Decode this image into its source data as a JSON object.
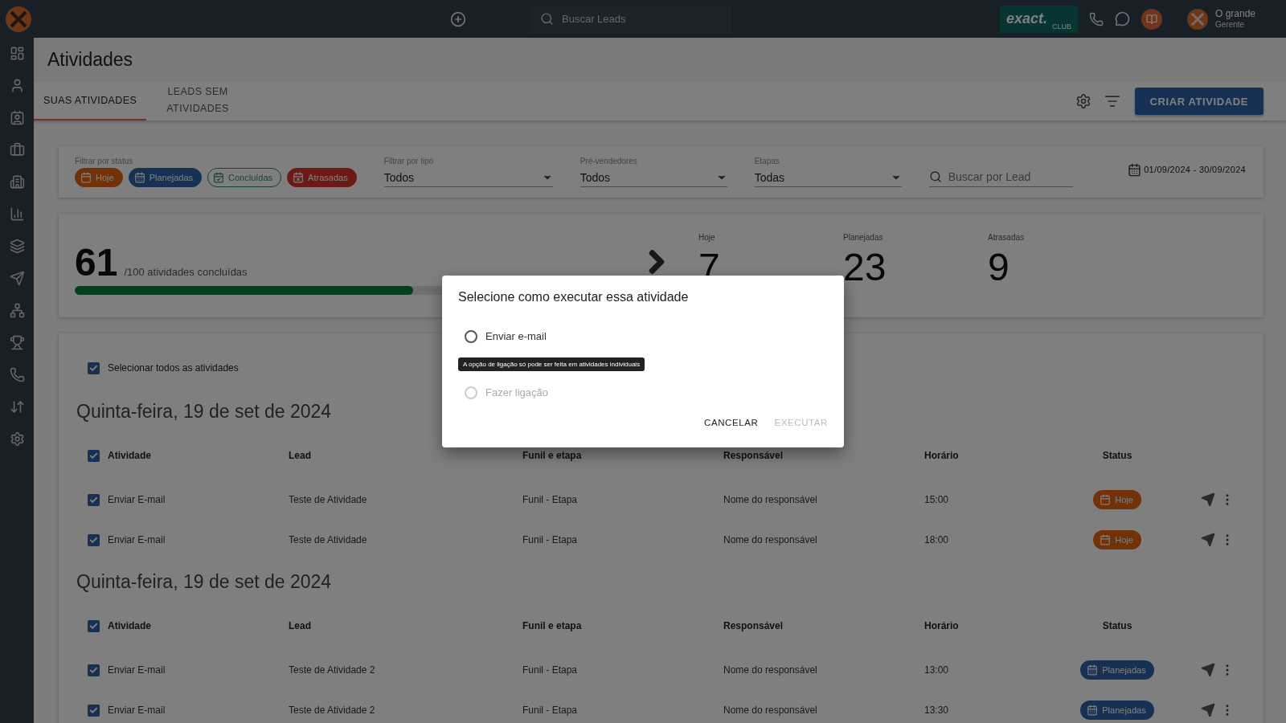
{
  "topbar": {
    "search": {
      "placeholder": "Buscar Leads"
    },
    "brand": {
      "name": "exact.",
      "sub": "CLUB"
    },
    "user": {
      "name": "O grande",
      "role": "Gerente"
    }
  },
  "page": {
    "title": "Atividades"
  },
  "tabs": [
    {
      "label": "SUAS ATIVIDADES",
      "selected": true
    },
    {
      "label": "LEADS SEM ATIVIDADES",
      "selected": false
    }
  ],
  "create_button": "CRIAR ATIVIDADE",
  "filters": {
    "status_label": "Filtrar por status",
    "status_chips": [
      {
        "label": "Hoje",
        "kind": "today",
        "selected": true
      },
      {
        "label": "Planejadas",
        "kind": "planned",
        "selected": true
      },
      {
        "label": "Concluídas",
        "kind": "done",
        "selected": false
      },
      {
        "label": "Atrasadas",
        "kind": "late",
        "selected": true
      }
    ],
    "selects": [
      {
        "label": "Filtrar por tipo",
        "value": "Todos"
      },
      {
        "label": "Pré-vendedores",
        "value": "Todos"
      },
      {
        "label": "Etapas",
        "value": "Todas"
      }
    ],
    "search": {
      "placeholder": "Buscar por Lead"
    },
    "date_range": "01/09/2024 - 30/09/2024"
  },
  "summary": {
    "done": "61",
    "total_text": "/100 atividades concluídas",
    "level": 0.61,
    "stats": [
      {
        "label": "Hoje",
        "value": "7"
      },
      {
        "label": "Planejadas",
        "value": "23"
      },
      {
        "label": "Atrasadas",
        "value": "9"
      }
    ]
  },
  "list": {
    "select_all": {
      "label": "Selecionar todos as atividades",
      "checked": true
    },
    "groups": [
      {
        "date": "Quinta-feira, 19 de set de 2024",
        "header_checked": true,
        "columns": [
          "Atividade",
          "Lead",
          "Funil e etapa",
          "Responsável",
          "Horário",
          "Status"
        ],
        "rows": [
          {
            "checked": true,
            "activity": "Enviar E-mail",
            "lead": "Teste de Atividade",
            "funnel": "Funil - Etapa",
            "owner": "Nome do responsável",
            "time": "15:00",
            "status": {
              "label": "Hoje",
              "kind": "today"
            }
          },
          {
            "checked": true,
            "activity": "Enviar E-mail",
            "lead": "Teste de Atividade",
            "funnel": "Funil - Etapa",
            "owner": "Nome do responsável",
            "time": "18:00",
            "status": {
              "label": "Hoje",
              "kind": "today"
            }
          }
        ]
      },
      {
        "date": "Quinta-feira, 19 de set de 2024",
        "header_checked": true,
        "columns": [
          "Atividade",
          "Lead",
          "Funil e etapa",
          "Responsável",
          "Horário",
          "Status"
        ],
        "rows": [
          {
            "checked": true,
            "activity": "Enviar E-mail",
            "lead": "Teste de Atividade 2",
            "funnel": "Funil - Etapa",
            "owner": "Nome do responsável",
            "time": "13:00",
            "status": {
              "label": "Planejadas",
              "kind": "planned"
            }
          },
          {
            "checked": true,
            "activity": "Enviar E-mail",
            "lead": "Teste de Atividade 2",
            "funnel": "Funil - Etapa",
            "owner": "Nome do responsável",
            "time": "13:30",
            "status": {
              "label": "Planejadas",
              "kind": "planned"
            }
          }
        ]
      }
    ]
  },
  "dialog": {
    "title": "Selecione como executar essa atividade",
    "options": [
      {
        "label": "Enviar e-mail",
        "selected": false,
        "disabled": false
      },
      {
        "label": "Fazer ligação",
        "selected": false,
        "disabled": true
      }
    ],
    "tooltip": "A opção de ligação só pode ser feita em atividades individuais",
    "buttons": [
      {
        "label": "CANCELAR",
        "disabled": false
      },
      {
        "label": "EXECUTAR",
        "disabled": true
      }
    ]
  }
}
